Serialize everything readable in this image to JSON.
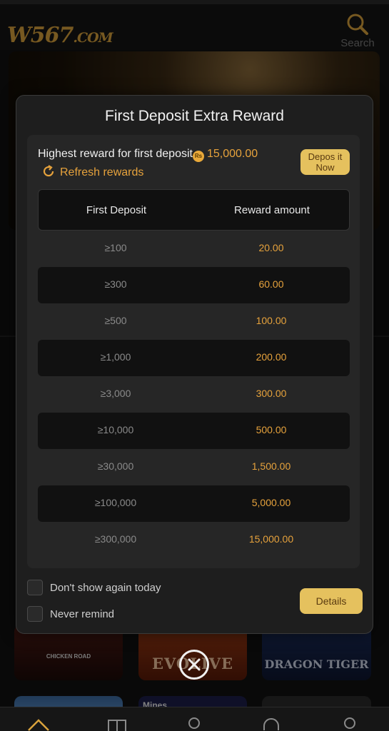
{
  "header": {
    "logo_main": "W567",
    "logo_suffix": ".COM",
    "search_label": "Search"
  },
  "background": {
    "tile_chicken": "CHICKEN ROAD",
    "tile_evo": "EVOLIVE",
    "tile_dragon": "DRAGON TIGER",
    "tile_mines": "Mines"
  },
  "modal": {
    "title": "First Deposit Extra Reward",
    "highest_label": "Highest reward for first deposit",
    "currency_symbol": "Rs",
    "highest_amount": "15,000.00",
    "refresh_label": "Refresh rewards",
    "deposit_button": "Depos it Now",
    "col_deposit": "First Deposit",
    "col_reward": "Reward amount",
    "rows": [
      {
        "deposit": "≥100",
        "reward": "20.00"
      },
      {
        "deposit": "≥300",
        "reward": "60.00"
      },
      {
        "deposit": "≥500",
        "reward": "100.00"
      },
      {
        "deposit": "≥1,000",
        "reward": "200.00"
      },
      {
        "deposit": "≥3,000",
        "reward": "300.00"
      },
      {
        "deposit": "≥10,000",
        "reward": "500.00"
      },
      {
        "deposit": "≥30,000",
        "reward": "1,500.00"
      },
      {
        "deposit": "≥100,000",
        "reward": "5,000.00"
      },
      {
        "deposit": "≥300,000",
        "reward": "15,000.00"
      }
    ],
    "dont_show_label": "Don't show again today",
    "never_remind_label": "Never remind",
    "details_button": "Details"
  },
  "colors": {
    "accent": "#e6a23c",
    "button_bg": "#e5c15e"
  }
}
